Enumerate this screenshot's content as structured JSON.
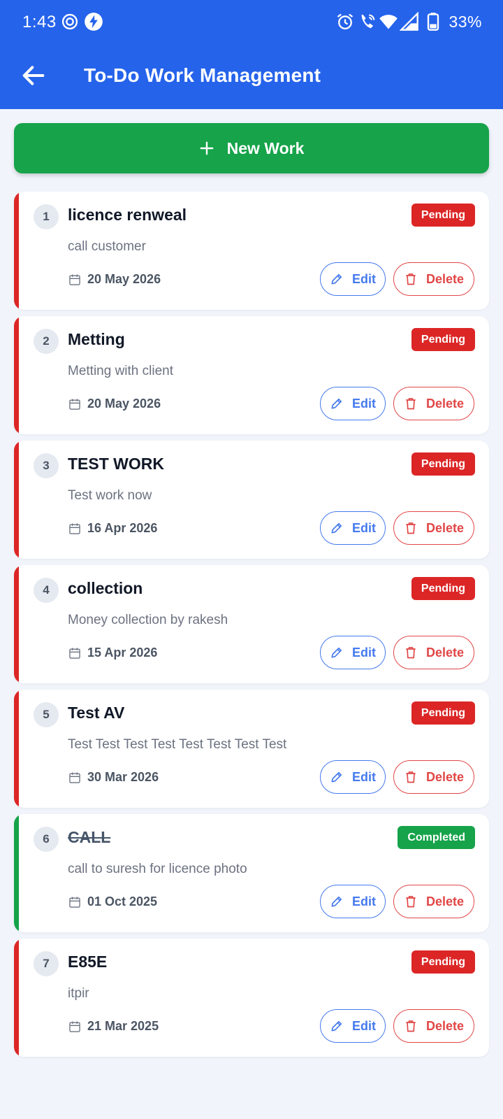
{
  "status_bar": {
    "time": "1:43",
    "battery": "33%"
  },
  "toolbar": {
    "title": "To-Do Work Management"
  },
  "actions": {
    "new_work_label": "New Work"
  },
  "tasks": [
    {
      "number": "1",
      "title": "licence renweal",
      "description": "call customer",
      "date": "20 May 2026",
      "status": "Pending"
    },
    {
      "number": "2",
      "title": "Metting",
      "description": "Metting with client",
      "date": "20 May 2026",
      "status": "Pending"
    },
    {
      "number": "3",
      "title": "TEST WORK",
      "description": "Test work now",
      "date": "16 Apr 2026",
      "status": "Pending"
    },
    {
      "number": "4",
      "title": "collection",
      "description": "Money collection by rakesh",
      "date": "15 Apr 2026",
      "status": "Pending"
    },
    {
      "number": "5",
      "title": "Test AV",
      "description": "Test Test Test Test Test Test Test Test",
      "date": "30 Mar 2026",
      "status": "Pending"
    },
    {
      "number": "6",
      "title": "CALL",
      "description": "call to suresh for licence photo",
      "date": "01 Oct 2025",
      "status": "Completed"
    },
    {
      "number": "7",
      "title": "E85E",
      "description": "itpir",
      "date": "21 Mar 2025",
      "status": "Pending"
    }
  ],
  "card_labels": {
    "edit": "Edit",
    "delete": "Delete"
  },
  "colors": {
    "primary": "#2563eb",
    "success": "#16a34a",
    "danger": "#dc2626",
    "background": "#f1f5fb"
  }
}
